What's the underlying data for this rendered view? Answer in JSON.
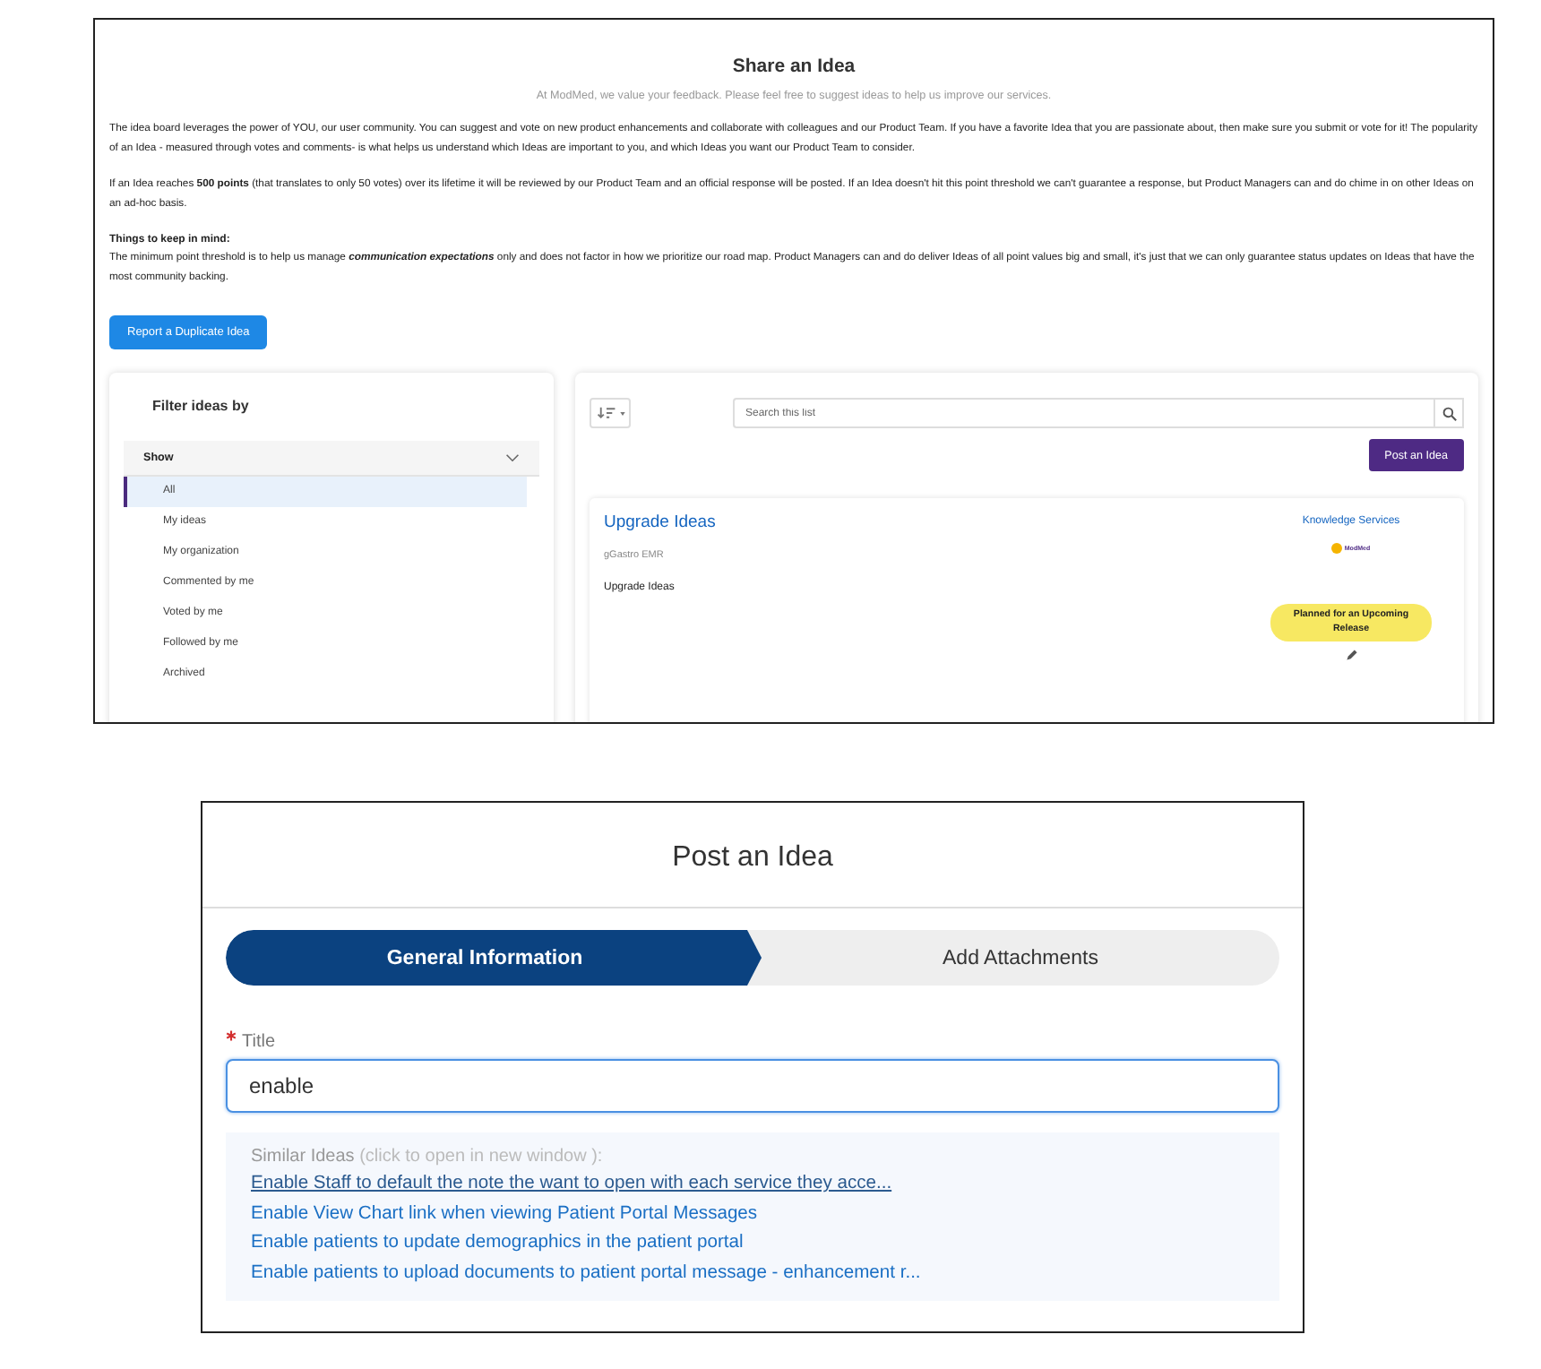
{
  "board": {
    "title": "Share an Idea",
    "subtitle": "At ModMed, we value your feedback. Please feel free to suggest ideas to help us improve our services.",
    "paragraphs": [
      "The idea board leverages the power of YOU, our user community. You can suggest and vote on new product enhancements and collaborate with colleagues and our Product Team. If you have a favorite Idea that you are passionate about, then make sure you submit or vote for it! The popularity of an Idea - measured through votes and comments- is what helps us understand which Ideas are important to you, and which Ideas you want our Product Team to consider.",
      "If an Idea reaches **500 points** (that translates to only 50 votes) over its lifetime it will be reviewed by our Product Team and an official response will be posted. If an Idea doesn't hit this point threshold we can't guarantee a response, but Product Managers can and do chime in on other Ideas on an ad-hoc basis."
    ],
    "keep_in_mind": {
      "heading": "Things to keep in mind:",
      "text": "The minimum point threshold is to help us manage **communication expectations** only and does not factor in how we prioritize our road map. Product Managers can and do deliver Ideas of all point values big and small, it's just that we can only guarantee status updates on Ideas that have the most community backing."
    },
    "duplicate_button": "Report a Duplicate Idea",
    "filter": {
      "title": "Filter ideas by",
      "section": "Show",
      "expanded": true,
      "items": [
        {
          "label": "All",
          "selected": true
        },
        {
          "label": "My ideas",
          "selected": false
        },
        {
          "label": "My organization",
          "selected": false
        },
        {
          "label": "Commented by me",
          "selected": false
        },
        {
          "label": "Voted by me",
          "selected": false
        },
        {
          "label": "Followed by me",
          "selected": false
        },
        {
          "label": "Archived",
          "selected": false
        }
      ]
    },
    "list": {
      "search_placeholder": "Search this list",
      "post_button": "Post an Idea",
      "ideas": [
        {
          "title": "Upgrade Ideas",
          "product": "gGastro EMR",
          "description": "Upgrade Ideas",
          "category": "Knowledge Services",
          "logo_text": "ModMed",
          "status": "Planned for an Upcoming Release"
        }
      ]
    }
  },
  "dialog": {
    "title": "Post an Idea",
    "steps": [
      {
        "label": "General Information",
        "selected": true
      },
      {
        "label": "Add Attachments",
        "selected": false
      }
    ],
    "field": {
      "label": "Title",
      "required": true,
      "value": "enable"
    },
    "similar": {
      "heading": "Similar Ideas",
      "hint": "(click to open in new window ):",
      "links": [
        {
          "text": "Enable Staff to default the note the want to open with each service they acce...",
          "hovered": true
        },
        {
          "text": "Enable View Chart link when viewing Patient Portal Messages",
          "hovered": false
        },
        {
          "text": "Enable patients to update demographics in the patient portal",
          "hovered": false
        },
        {
          "text": "Enable patients to upload documents to patient portal message - enhancement r...",
          "hovered": false
        }
      ]
    }
  }
}
